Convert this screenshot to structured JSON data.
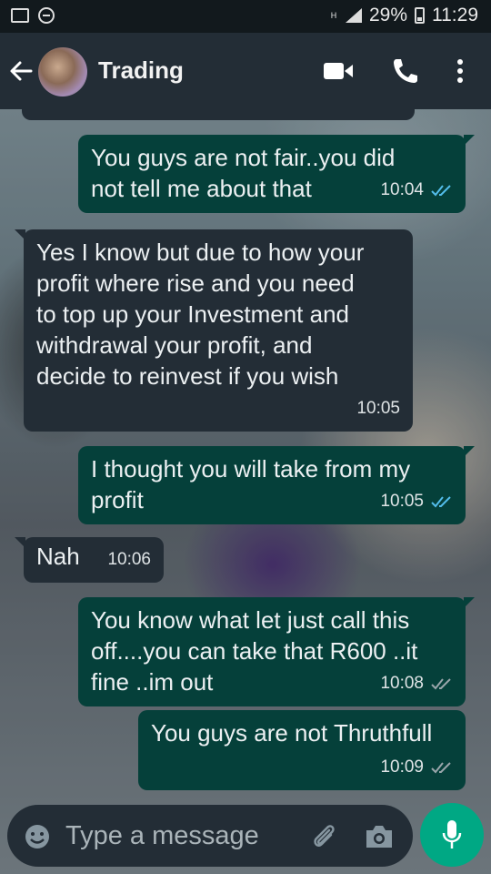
{
  "status_bar": {
    "network_type": "H",
    "battery_percent": "29%",
    "time": "11:29"
  },
  "header": {
    "title": "Trading"
  },
  "messages": [
    {
      "direction": "outgoing",
      "text": "You guys are not fair..you did\nnot tell me about that",
      "time": "10:04",
      "ticks": "double-check"
    },
    {
      "direction": "incoming",
      "text": "Yes I know but due to how your\nprofit where rise and you need\nto top up your Investment and\nwithdrawal your profit, and\ndecide to reinvest if you wish",
      "time": "10:05"
    },
    {
      "direction": "outgoing",
      "text": "I thought you will take from my\nprofit",
      "time": "10:05",
      "ticks": "double-check"
    },
    {
      "direction": "incoming",
      "text": "Nah",
      "time": "10:06"
    },
    {
      "direction": "outgoing",
      "text": "You know what let just call this\noff....you can take that R600 ..it\nfine ..im out",
      "time": "10:08",
      "ticks": "double-check"
    },
    {
      "direction": "outgoing",
      "text": "You guys are not Thruthfull",
      "time": "10:09",
      "ticks": "double-check"
    }
  ],
  "composer": {
    "placeholder": "Type a message"
  },
  "colors": {
    "header_bg": "#232d36",
    "incoming_bubble": "#232d36",
    "outgoing_bubble": "#05403a",
    "mic_button": "#00a884",
    "read_ticks": "#53bdeb"
  }
}
